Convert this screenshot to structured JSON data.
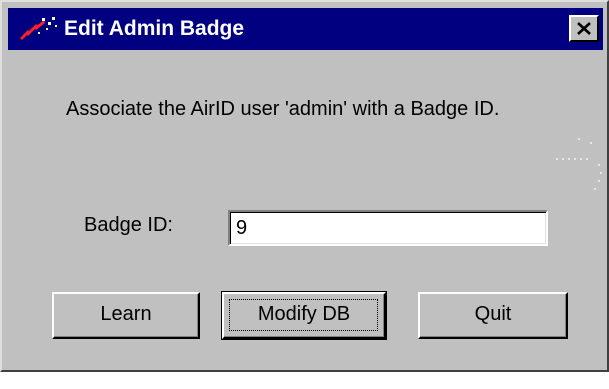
{
  "window": {
    "title": "Edit Admin Badge",
    "icon": "airid-app-icon",
    "close_icon": "close-icon"
  },
  "message": "Associate the AirID user 'admin' with a Badge ID.",
  "badge": {
    "label": "Badge ID:",
    "value": "9"
  },
  "buttons": {
    "learn": "Learn",
    "modify": "Modify DB",
    "quit": "Quit"
  },
  "colors": {
    "titlebar": "#000080",
    "dialog_face": "#c0c0c0",
    "title_text": "#ffffff"
  }
}
